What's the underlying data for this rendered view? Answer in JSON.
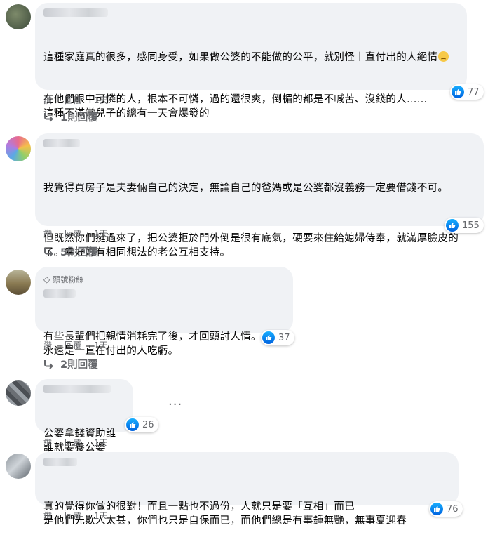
{
  "comments": [
    {
      "badge": "",
      "paragraphs": [
        "這種家庭真的很多，感同身受，如果做公婆的不能做的公平，就別怪丨直付出的人絕情",
        "在他們眼中可憐的人，根本不可憐，過的還很爽，倒楣的都是不喊苦、沒錢的人……\n這種不滿當兒子的總有一天會爆發的"
      ],
      "reactions": "77",
      "actions": {
        "like": "讚",
        "reply": "回覆",
        "time": "1天"
      },
      "replies": "1則回覆"
    },
    {
      "badge": "",
      "paragraphs": [
        "我覺得買房子是夫妻倆自己的決定，無論自己的爸媽或是公婆都沒義務一定要借錢不可。",
        "但既然你們挺過來了，把公婆拒於門外倒是很有底氣，硬要來住給媳婦侍奉，就滿厚臉皮的了。幸好妳有相同想法的老公互相支持。"
      ],
      "reactions": "155",
      "actions": {
        "like": "讚",
        "reply": "回覆",
        "time": "1天"
      },
      "replies": "5則回覆"
    },
    {
      "badge": "頭號粉絲",
      "paragraphs": [
        "有些長輩們把親情消耗完了後，才回頭討人情。\n永遠是一直在付出的人吃虧。"
      ],
      "reactions": "37",
      "actions": {
        "like": "讚",
        "reply": "回覆",
        "time": "1天"
      },
      "replies": "2則回覆"
    },
    {
      "badge": "",
      "paragraphs": [
        "公婆拿錢資助誰\n誰就要養公婆"
      ],
      "reactions": "26",
      "actions": {
        "like": "讚",
        "reply": "回覆",
        "time": "1天"
      },
      "replies": ""
    },
    {
      "badge": "",
      "paragraphs": [
        "真的覺得你做的很對！而且一點也不過份，人就只是要「互相」而已\n是他們先欺人太甚，你們也只是自保而已，而他們總是有事鍾無艷，無事夏迎春"
      ],
      "reactions": "76",
      "actions": {
        "like": "讚",
        "reply": "回覆",
        "time": "1天"
      },
      "replies": ""
    }
  ],
  "colors": {
    "bubble_bg": "#f0f2f5",
    "meta_text": "#65676b",
    "like_blue": "#1877f2"
  },
  "icons": {
    "like": "thumbs-up-icon",
    "reply_arrow": "reply-arrow-icon",
    "badge": "diamond-icon",
    "more": "more-options-icon",
    "emoji": "sweat-smile-emoji"
  }
}
